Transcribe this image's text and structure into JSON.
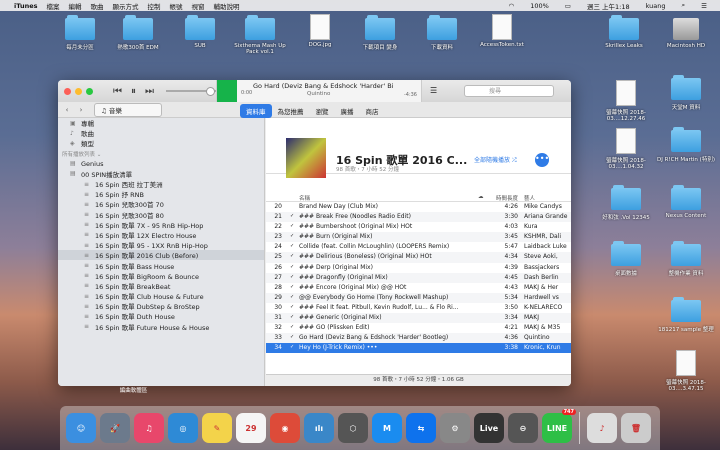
{
  "menubar": {
    "app": "iTunes",
    "items": [
      "檔案",
      "編輯",
      "歌曲",
      "顯示方式",
      "控制",
      "帳號",
      "視窗",
      "輔助說明"
    ],
    "battery": "100%",
    "datetime": "週三 上午1:18",
    "user": "kuang"
  },
  "desktop": [
    {
      "label": "每月未分區",
      "kind": "folder"
    },
    {
      "label": "熱歌300首 EDM",
      "kind": "folder"
    },
    {
      "label": "SUB",
      "kind": "folder"
    },
    {
      "label": "Sixthema Mash Up Pack vol.1",
      "kind": "folder"
    },
    {
      "label": "DOG.jpg",
      "kind": "doc"
    },
    {
      "label": "下載項目 變身",
      "kind": "folder"
    },
    {
      "label": "下載資料",
      "kind": "folder"
    },
    {
      "label": "AccessToken.txt",
      "kind": "doc"
    },
    {
      "label": "Skrillex Leaks",
      "kind": "folder"
    },
    {
      "label": "Macintosh HD",
      "kind": "drive"
    },
    {
      "label": "天堂M 資料",
      "kind": "folder"
    },
    {
      "label": "螢幕快照 2018-03....12.27.46",
      "kind": "doc"
    },
    {
      "label": "螢幕快照 2018-03....1.04.32",
      "kind": "doc"
    },
    {
      "label": "DJ R!CH Martin (特別)",
      "kind": "folder"
    },
    {
      "label": "好和弦 .Vol 12345",
      "kind": "folder"
    },
    {
      "label": "Nexus Content",
      "kind": "folder"
    },
    {
      "label": "桌面數據",
      "kind": "folder"
    },
    {
      "label": "整機作業 資料",
      "kind": "folder"
    },
    {
      "label": "181217 sample 整理",
      "kind": "folder"
    },
    {
      "label": "螢幕快照 2018-03....3.47.15",
      "kind": "doc"
    }
  ],
  "player": {
    "track": "Go Hard (Deviz Bang & Edshock 'Harder' Bi",
    "artist": "Quintino",
    "elapsed": "0:00",
    "remaining": "-4:36",
    "search_placeholder": "搜尋"
  },
  "toolbar": {
    "media": "音樂",
    "tabs": [
      "資料庫",
      "為您推薦",
      "瀏覽",
      "廣播",
      "商店"
    ],
    "selected_tab": 0
  },
  "sidebar": {
    "library": [
      {
        "label": "專輯",
        "icon": "album-icon"
      },
      {
        "label": "歌曲",
        "icon": "note-icon"
      },
      {
        "label": "類型",
        "icon": "genre-icon"
      }
    ],
    "playlists_header": "所有播放列表 ⌄",
    "playlists": [
      {
        "label": "Genius",
        "indent": false
      },
      {
        "label": "00 SPIN播放清單",
        "indent": false
      },
      {
        "label": "16 Spin 西班 拉丁美洲",
        "indent": true
      },
      {
        "label": "16 Spin 抒 RNB",
        "indent": true
      },
      {
        "label": "16 Spin 兒歌300首 70",
        "indent": true
      },
      {
        "label": "16 Spin 兒歌300首 80",
        "indent": true
      },
      {
        "label": "16 Spin 歌單 7X - 95 RnB Hip-Hop",
        "indent": true
      },
      {
        "label": "16 Spin 歌單 12X Electro House",
        "indent": true
      },
      {
        "label": "16 Spin 歌單 95 - 1XX RnB Hip-Hop",
        "indent": true
      },
      {
        "label": "16 Spin 歌單 2016 Club (Before)",
        "indent": true,
        "selected": true
      },
      {
        "label": "16 Spin 歌單 Bass House",
        "indent": true
      },
      {
        "label": "16 Spin 歌單 BigRoom & Bounce",
        "indent": true
      },
      {
        "label": "16 Spin 歌單 BreakBeat",
        "indent": true
      },
      {
        "label": "16 Spin 歌單 Club House & Future",
        "indent": true
      },
      {
        "label": "16 Spin 歌單 DubStep & BroStep",
        "indent": true
      },
      {
        "label": "16 Spin 歌單 Duth House",
        "indent": true
      },
      {
        "label": "16 Spin 歌單 Future House & House",
        "indent": true
      }
    ],
    "footer": "編曲軟體區"
  },
  "playlist": {
    "title": "16 Spin 歌單 2016 C...",
    "subtitle": "98 首歌・7 小時 52 分鐘",
    "shuffle": "全部隨機播放 ⤮",
    "more": "•••"
  },
  "columns": {
    "name": "名稱",
    "duration": "時間長度",
    "artist": "藝人"
  },
  "tracks": [
    {
      "n": "20",
      "check": "",
      "title": "Brand New Day (Club Mix)",
      "dur": "4:26",
      "artist": "Mike Candys"
    },
    {
      "n": "21",
      "check": "✓",
      "title": "### Break Free (Noodles Radio Edit)",
      "dur": "3:30",
      "artist": "Ariana Grande"
    },
    {
      "n": "22",
      "check": "✓",
      "title": "### Bumbershoot (Original Mix) HOt",
      "dur": "4:03",
      "artist": "Kura"
    },
    {
      "n": "23",
      "check": "✓",
      "title": "### Burn (Original Mix)",
      "dur": "3:45",
      "artist": "KSHMR, Dali"
    },
    {
      "n": "24",
      "check": "✓",
      "title": "Collide (feat. Collin McLoughlin) (LOOPERS Remix)",
      "dur": "5:47",
      "artist": "Laidback Luke"
    },
    {
      "n": "25",
      "check": "✓",
      "title": "### Delirious (Boneless) (Original Mix) HOt",
      "dur": "4:34",
      "artist": "Steve Aoki,"
    },
    {
      "n": "26",
      "check": "✓",
      "title": "### Derp (Original Mix)",
      "dur": "4:39",
      "artist": "Bassjackers"
    },
    {
      "n": "27",
      "check": "✓",
      "title": "### Dragonfly (Original Mix)",
      "dur": "4:45",
      "artist": "Dash Berlin"
    },
    {
      "n": "28",
      "check": "✓",
      "title": "### Encore (Original Mix) @@ HOt",
      "dur": "4:43",
      "artist": "MAKJ & Her"
    },
    {
      "n": "29",
      "check": "✓",
      "title": "@@ Everybody Go Home (Tony Rockwell Mashup)",
      "dur": "5:34",
      "artist": "Hardwell vs"
    },
    {
      "n": "30",
      "check": "✓",
      "title": "### Feel It feat. Pitbull, Kevin Rudolf, Lu... & Flo Ri...",
      "dur": "3:50",
      "artist": "K-NELARECO"
    },
    {
      "n": "31",
      "check": "✓",
      "title": "### Generic (Original Mix)",
      "dur": "3:34",
      "artist": "MAKJ"
    },
    {
      "n": "32",
      "check": "✓",
      "title": "### GO (Plissken Edit)",
      "dur": "4:21",
      "artist": "MAKJ & M35"
    },
    {
      "n": "33",
      "check": "✓",
      "title": "Go Hard (Deviz Bang & Edshock 'Harder' Bootleg)",
      "dur": "4:36",
      "artist": "Quintino"
    },
    {
      "n": "34",
      "check": "✓",
      "title": "Hey Ho (J-Trick Remix) •••",
      "dur": "3:38",
      "artist": "Kronic, Krun",
      "selected": true
    }
  ],
  "status": "98 首歌・7 小時 52 分鐘・1.06 GB",
  "dock": [
    {
      "name": "finder",
      "label": "☺",
      "color": "#3b8fe0"
    },
    {
      "name": "launchpad",
      "label": "🚀",
      "color": "#6c7a8c"
    },
    {
      "name": "itunes",
      "label": "♫",
      "color": "#e8476b"
    },
    {
      "name": "safari",
      "label": "◎",
      "color": "#2e8ad6"
    },
    {
      "name": "notes",
      "label": "✎",
      "color": "#f3d34a"
    },
    {
      "name": "calendar",
      "label": "29",
      "color": "#f5f5f5"
    },
    {
      "name": "chrome",
      "label": "◉",
      "color": "#dd4b39"
    },
    {
      "name": "audio-app",
      "label": "ılı",
      "color": "#3a87c8"
    },
    {
      "name": "cube-app",
      "label": "⬡",
      "color": "#555"
    },
    {
      "name": "m-app",
      "label": "M",
      "color": "#1a8cf0"
    },
    {
      "name": "teamviewer",
      "label": "⇆",
      "color": "#0e72ed"
    },
    {
      "name": "system-prefs",
      "label": "⚙",
      "color": "#888"
    },
    {
      "name": "live",
      "label": "Live",
      "color": "#333"
    },
    {
      "name": "vpn-app",
      "label": "⊖",
      "color": "#555"
    },
    {
      "name": "line",
      "label": "LINE",
      "color": "#2ebf46",
      "badge": "747"
    },
    {
      "name": "documents",
      "label": "♪",
      "color": "#ddd"
    },
    {
      "name": "trash",
      "label": "🗑",
      "color": "#ccc"
    }
  ]
}
